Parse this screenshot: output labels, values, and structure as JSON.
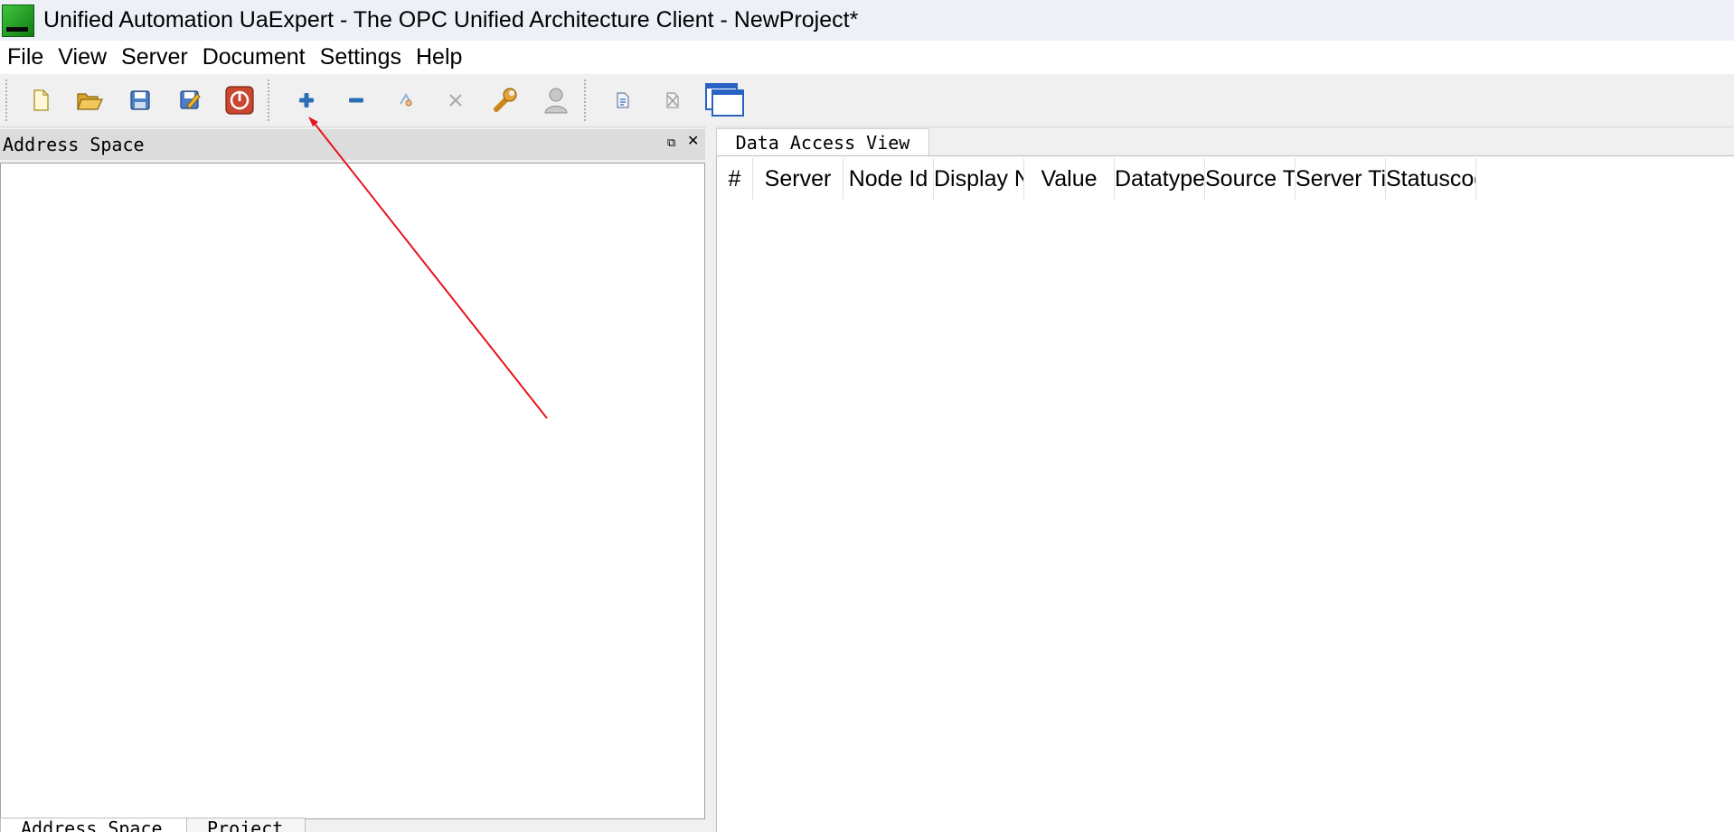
{
  "window": {
    "title": "Unified Automation UaExpert - The OPC Unified Architecture Client - NewProject*"
  },
  "menu": [
    "File",
    "View",
    "Server",
    "Document",
    "Settings",
    "Help"
  ],
  "toolbar": {
    "buttons": [
      {
        "icon": "new-project-icon"
      },
      {
        "icon": "open-project-icon"
      },
      {
        "icon": "save-project-icon"
      },
      {
        "icon": "save-as-icon"
      },
      {
        "icon": "exit-icon"
      },
      {
        "icon": "add-server-icon"
      },
      {
        "icon": "remove-server-icon"
      },
      {
        "icon": "connect-server-icon"
      },
      {
        "icon": "disconnect-server-icon"
      },
      {
        "icon": "server-settings-icon"
      },
      {
        "icon": "user-icon"
      },
      {
        "icon": "add-document-icon"
      },
      {
        "icon": "remove-document-icon"
      },
      {
        "icon": "window-icon"
      }
    ]
  },
  "left_panel": {
    "title": "Address Space",
    "bottom_tabs": [
      "Address Space",
      "Project"
    ]
  },
  "right_panel": {
    "tab": "Data Access View",
    "columns": [
      "#",
      "Server",
      "Node Id",
      "Display Name",
      "Value",
      "Datatype",
      "Source Timestamp",
      "Server Timestamp",
      "Statuscode"
    ]
  },
  "colors": {
    "accent_blue": "#2a6fb5",
    "exit_red": "#c9472f",
    "annotation_red": "#e8141e"
  }
}
